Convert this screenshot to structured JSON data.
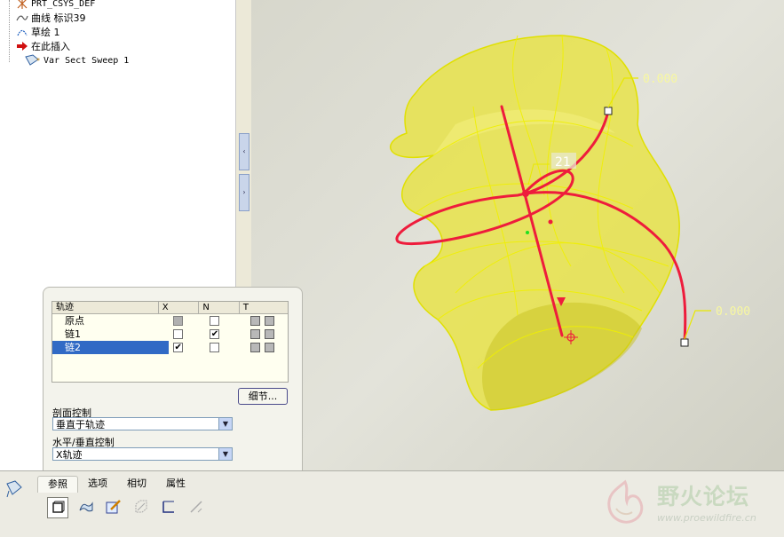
{
  "model_tree": {
    "items": [
      {
        "label": "PRT_CSYS_DEF",
        "icon": "csys-icon"
      },
      {
        "label": "曲线 标识39",
        "icon": "curve-icon"
      },
      {
        "label": "草绘 1",
        "icon": "sketch-icon"
      },
      {
        "label": "在此插入",
        "icon": "insert-arrow-icon"
      },
      {
        "label": "Var Sect Sweep 1",
        "icon": "var-sect-sweep-icon"
      }
    ]
  },
  "graphics": {
    "dim_top": "0.000",
    "dim_bottom": "0.000",
    "tag": "21",
    "colors": {
      "surface": "#e8e34a",
      "edge": "#e0e000",
      "trajectory": "#ee1c3c"
    }
  },
  "panel": {
    "table": {
      "headers": [
        "轨迹",
        "X",
        "N",
        "T"
      ],
      "rows": [
        {
          "name": "原点",
          "x": "grey",
          "n": "unchecked",
          "t": true,
          "selected": false
        },
        {
          "name": "链1",
          "x": "unchecked",
          "n": "checked",
          "t": true,
          "selected": false
        },
        {
          "name": "链2",
          "x": "checked",
          "n": "unchecked",
          "t": true,
          "selected": true
        }
      ],
      "check_glyph": "✔"
    },
    "details_button": "细节...",
    "section_control_label": "剖面控制",
    "section_control_value": "垂直于轨迹",
    "hv_control_label": "水平/垂直控制",
    "hv_control_value": "X轨迹"
  },
  "dashboard": {
    "tabs": [
      "参照",
      "选项",
      "相切",
      "属性"
    ],
    "active_tab": 0,
    "tools": [
      "solid-icon",
      "surface-icon",
      "sketch-section-icon",
      "remove-material-icon",
      "thicken-icon",
      "reparam-icon"
    ]
  },
  "watermark": {
    "title": "野火论坛",
    "url": "www.proewildfire.cn"
  }
}
